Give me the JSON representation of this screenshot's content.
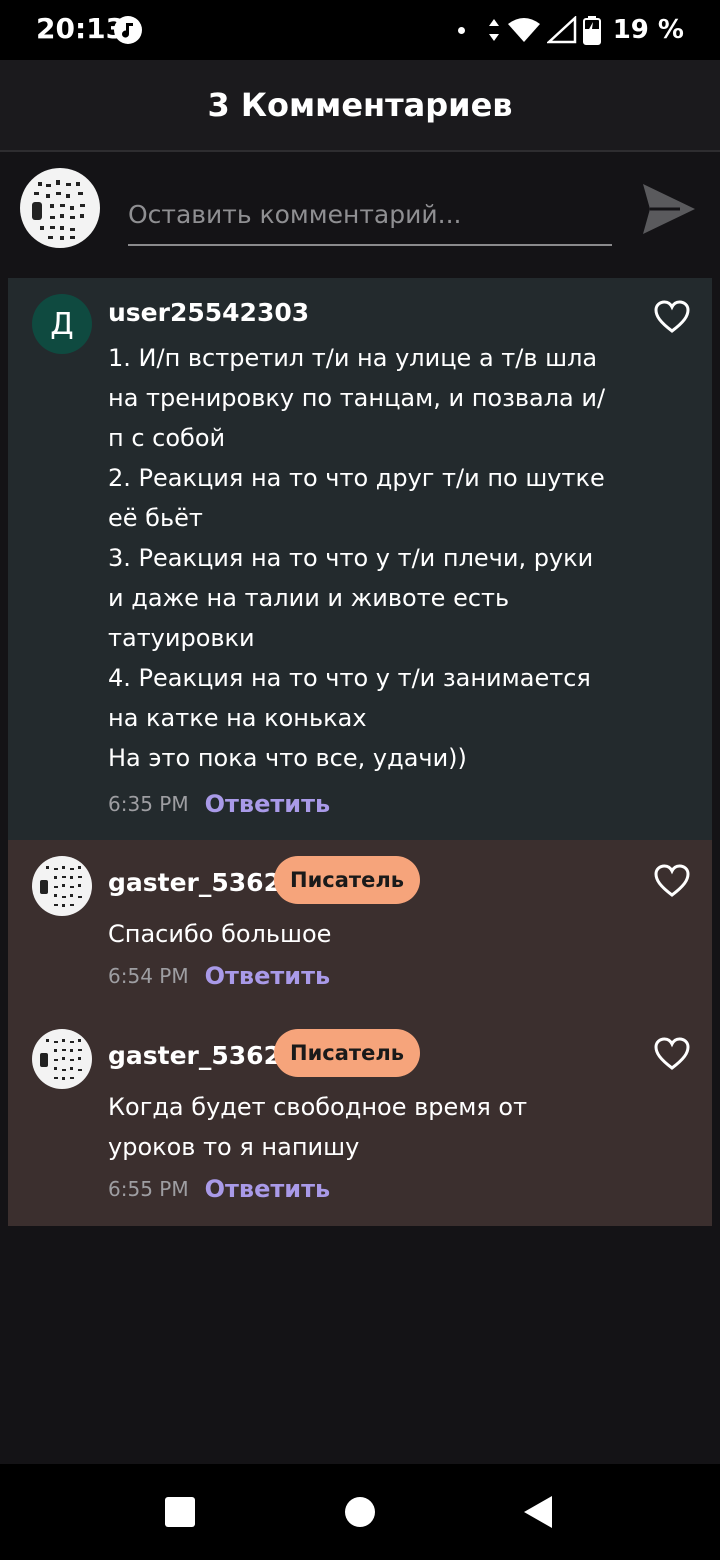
{
  "status": {
    "time": "20:13",
    "battery": "19 %"
  },
  "header": {
    "title": "3 Комментариев"
  },
  "composer": {
    "placeholder": "Оставить комментарий..."
  },
  "comments": [
    {
      "avatar_letter": "Д",
      "username": "user25542303",
      "badge": "",
      "lines": [
        "1. И/п встретил т/и на улице а т/в шла",
        "на тренировку по танцам, и позвала и/",
        "п с собой",
        "2. Реакция на то что друг т/и по шутке",
        "её бьёт",
        "3. Реакция на то что у т/и плечи, руки",
        "и даже на талии и животе есть",
        "татуировки",
        "4. Реакция на то что у т/и занимается",
        "на катке на коньках",
        "На это пока что все, удачи))"
      ],
      "time": "6:35 PM",
      "reply": "Ответить"
    },
    {
      "username": "gaster_5362",
      "badge": "Писатель",
      "lines": [
        "Спасибо большое"
      ],
      "time": "6:54 PM",
      "reply": "Ответить"
    },
    {
      "username": "gaster_5362",
      "badge": "Писатель",
      "lines": [
        "Когда будет свободное время от",
        "уроков то я напишу"
      ],
      "time": "6:55 PM",
      "reply": "Ответить"
    }
  ],
  "colors": {
    "background": "#141316",
    "comment_bg_author": "#232a2d",
    "comment_bg_writer": "#3b2f2e",
    "badge": "#f6a47b",
    "reply": "#a99ae8"
  },
  "icons": [
    "music-note-icon",
    "wifi-icon",
    "signal-icon",
    "battery-icon",
    "send-icon",
    "heart-icon"
  ]
}
